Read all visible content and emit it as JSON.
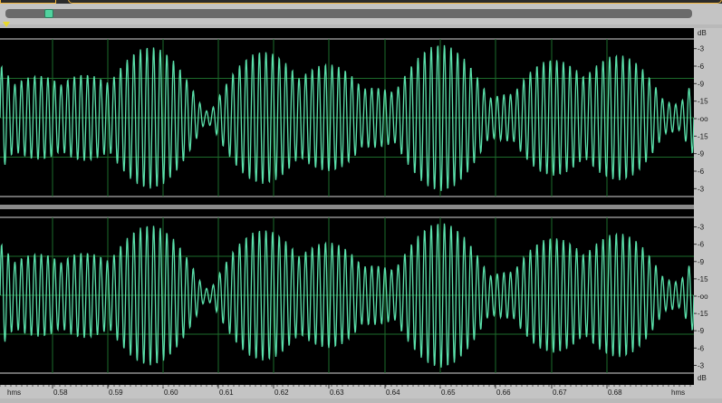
{
  "colors": {
    "waveform": "#5ae0aa",
    "background": "#000000",
    "grid": "#1d6b2c",
    "ruler_bg": "#c4c4c4",
    "marker": "#e9d92b"
  },
  "level_ruler": {
    "unit": "dB",
    "channel_ticks": [
      "-3",
      "-6",
      "-9",
      "-15",
      "-oo",
      "-15",
      "-9",
      "-6",
      "-3"
    ]
  },
  "time_ruler": {
    "unit_left": "hms",
    "unit_right": "hms",
    "ticks": [
      "0.58",
      "0.59",
      "0.60",
      "0.61",
      "0.62",
      "0.63",
      "0.64",
      "0.65",
      "0.66",
      "0.67",
      "0.68"
    ]
  },
  "scrollbar": {
    "position_fraction": 0.06
  }
}
